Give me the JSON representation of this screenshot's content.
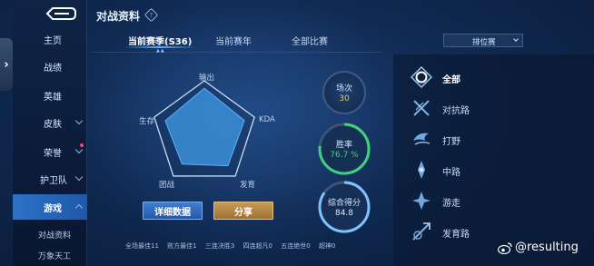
{
  "sidebar": {
    "items": [
      {
        "label": "主页"
      },
      {
        "label": "战绩"
      },
      {
        "label": "英雄"
      },
      {
        "label": "皮肤"
      },
      {
        "label": "荣誉"
      },
      {
        "label": "护卫队"
      },
      {
        "label": "游戏"
      }
    ],
    "sub_items": [
      {
        "label": "对战资料"
      },
      {
        "label": "万象天工"
      }
    ]
  },
  "header": {
    "title": "对战资料",
    "help_glyph": "?"
  },
  "tabs": [
    {
      "label": "当前赛季(S36)",
      "active": true
    },
    {
      "label": "当前赛年",
      "active": false
    },
    {
      "label": "全部比赛",
      "active": false
    }
  ],
  "tab_marker": "▲▲",
  "mode_select": {
    "value": "排位赛"
  },
  "radar": {
    "axes": [
      "输出",
      "KDA",
      "发育",
      "团战",
      "生存"
    ],
    "values": [
      0.86,
      0.8,
      0.76,
      0.72,
      0.78
    ]
  },
  "buttons": {
    "detail": "详细数据",
    "share": "分享"
  },
  "stats_summary": [
    "全场最佳11",
    "败方最佳1",
    "三连决胜3",
    "四连超凡0",
    "五连绝世0",
    "超神0"
  ],
  "metrics": {
    "matches": {
      "label": "场次",
      "value": "30"
    },
    "win_rate": {
      "label": "胜率",
      "value": "76.7 %",
      "fraction": 0.767
    },
    "score": {
      "label": "综合得分",
      "value": "84.8",
      "fraction": 0.848
    }
  },
  "roles": [
    {
      "label": "全部",
      "icon": "all-roles-icon",
      "active": true
    },
    {
      "label": "对抗路",
      "icon": "clash-lane-icon",
      "active": false
    },
    {
      "label": "打野",
      "icon": "jungle-icon",
      "active": false
    },
    {
      "label": "中路",
      "icon": "mid-lane-icon",
      "active": false
    },
    {
      "label": "游走",
      "icon": "roam-icon",
      "active": false
    },
    {
      "label": "发育路",
      "icon": "farm-lane-icon",
      "active": false
    }
  ],
  "watermark": {
    "text": "@resulting"
  },
  "colors": {
    "accent_blue": "#5cb0ff",
    "win_green": "#3fd27a",
    "score_blue": "#7fc0ff",
    "share_gold": "#c79a54"
  }
}
